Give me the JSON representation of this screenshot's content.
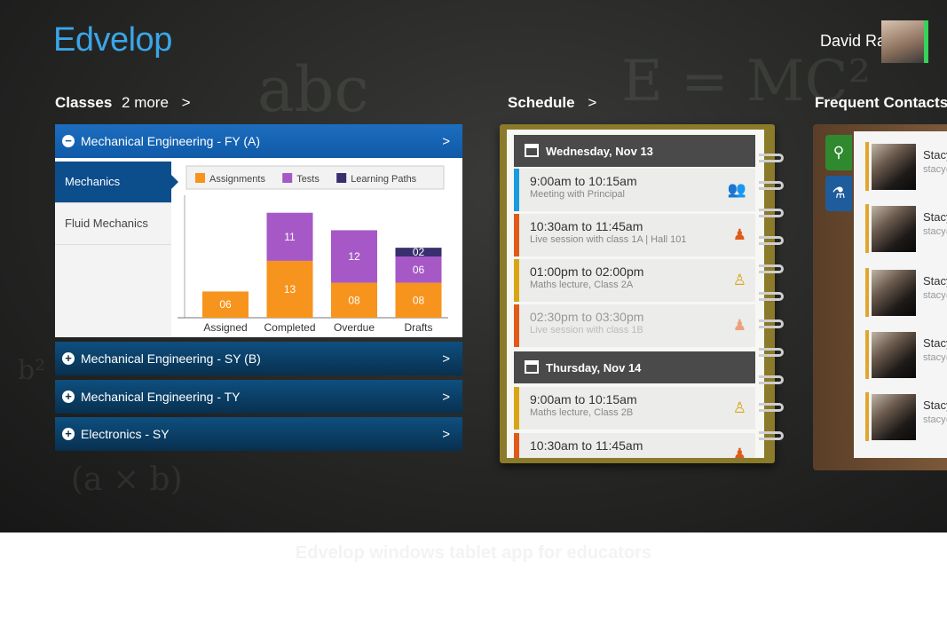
{
  "app": {
    "logo": "Edvelop",
    "user_name": "David Ray"
  },
  "classes": {
    "header": "Classes",
    "more": "2 more",
    "chevron": ">",
    "open_class": {
      "label": "Mechanical Engineering - FY (A)",
      "toggle": "−",
      "chevron": ">"
    },
    "subjects": [
      "Mechanics",
      "Fluid Mechanics"
    ],
    "collapsed": [
      {
        "label": "Mechanical Engineering - SY (B)",
        "toggle": "+",
        "chevron": ">"
      },
      {
        "label": "Mechanical Engineering - TY",
        "toggle": "+",
        "chevron": ">"
      },
      {
        "label": "Electronics - SY",
        "toggle": "+",
        "chevron": ">"
      }
    ]
  },
  "chart_data": {
    "type": "bar",
    "stacked": true,
    "categories": [
      "Assigned",
      "Completed",
      "Overdue",
      "Drafts"
    ],
    "series": [
      {
        "name": "Assignments",
        "color": "#f7941d",
        "values": [
          6,
          13,
          8,
          8
        ],
        "labels": [
          "06",
          "13",
          "08",
          "08"
        ]
      },
      {
        "name": "Tests",
        "color": "#a659c6",
        "values": [
          0,
          11,
          12,
          6
        ],
        "labels": [
          "",
          "11",
          "12",
          "06"
        ]
      },
      {
        "name": "Learning Paths",
        "color": "#3a2e6e",
        "values": [
          0,
          0,
          0,
          2
        ],
        "labels": [
          "",
          "",
          "",
          "02"
        ]
      }
    ],
    "ylim": [
      0,
      28
    ],
    "legend": "top"
  },
  "schedule": {
    "header": "Schedule",
    "chevron": ">",
    "days": [
      {
        "label": "Wednesday, Nov 13",
        "events": [
          {
            "time": "9:00am to 10:15am",
            "desc": "Meeting with Principal",
            "color": "#1a9be0",
            "icon": "people-icon",
            "glyph": "👥",
            "past": false
          },
          {
            "time": "10:30am to 11:45am",
            "desc": "Live session with class 1A    |   Hall 101",
            "color": "#e05a1a",
            "icon": "classroom-icon",
            "glyph": "♟",
            "past": false
          },
          {
            "time": "01:00pm to 02:00pm",
            "desc": "Maths lecture, Class 2A",
            "color": "#d9a514",
            "icon": "lecturer-icon",
            "glyph": "♙",
            "past": false
          },
          {
            "time": "02:30pm to 03:30pm",
            "desc": "Live session with class 1B",
            "color": "#e05a1a",
            "icon": "classroom-icon",
            "glyph": "♟",
            "past": true
          }
        ]
      },
      {
        "label": "Thursday, Nov 14",
        "events": [
          {
            "time": "9:00am to 10:15am",
            "desc": "Maths lecture, Class 2B",
            "color": "#d9a514",
            "icon": "lecturer-icon",
            "glyph": "♙",
            "past": false
          },
          {
            "time": "10:30am to 11:45am",
            "desc": "",
            "color": "#e05a1a",
            "icon": "classroom-icon",
            "glyph": "♟",
            "past": false
          }
        ]
      }
    ]
  },
  "contacts": {
    "header": "Frequent Contacts",
    "chevron": ">",
    "items": [
      {
        "name": "Stacy",
        "email": "stacy@"
      },
      {
        "name": "Stacy",
        "email": "stacy@"
      },
      {
        "name": "Stacy",
        "email": "stacy@"
      },
      {
        "name": "Stacy",
        "email": "stacy@"
      },
      {
        "name": "Stacy",
        "email": "stacy@"
      }
    ]
  },
  "caption": "Edvelop windows tablet app for educators",
  "colors": {
    "accent": "#1d6dbf",
    "bg": "#2a2b29",
    "user_status": "#35d35a"
  }
}
